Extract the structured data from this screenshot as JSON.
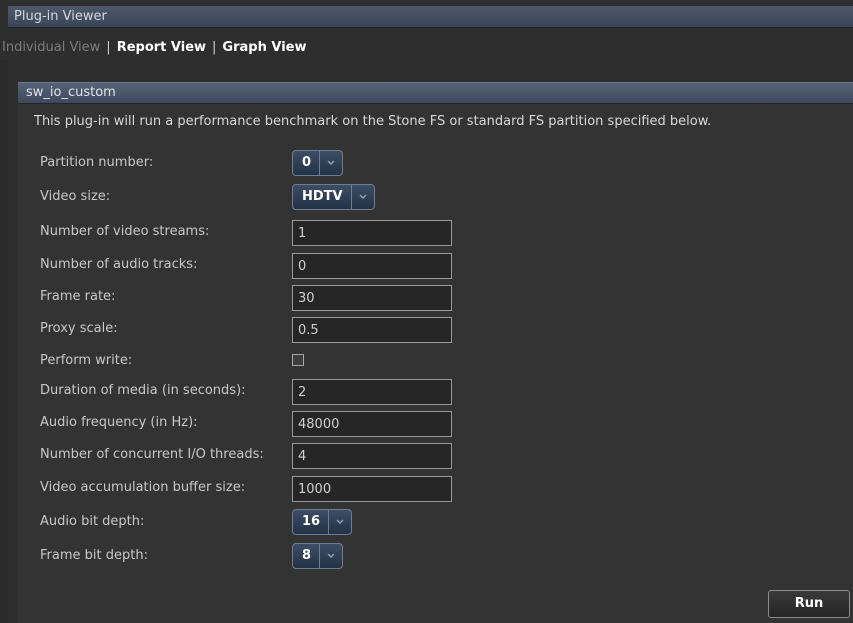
{
  "window": {
    "title": "Plug-in Viewer"
  },
  "tabs": [
    {
      "label": "Individual View",
      "state": "inactive"
    },
    {
      "label": "Report View",
      "state": "active"
    },
    {
      "label": "Graph View",
      "state": "active"
    }
  ],
  "tab_separator": "|",
  "panel": {
    "title": "sw_io_custom",
    "description": "This plug-in will run a performance benchmark on the Stone FS or standard FS partition specified below."
  },
  "fields": {
    "partition_number": {
      "label": "Partition number:",
      "value": "0"
    },
    "video_size": {
      "label": "Video size:",
      "value": "HDTV"
    },
    "video_streams": {
      "label": "Number of video streams:",
      "value": "1"
    },
    "audio_tracks": {
      "label": "Number of audio tracks:",
      "value": "0"
    },
    "frame_rate": {
      "label": "Frame rate:",
      "value": "30"
    },
    "proxy_scale": {
      "label": "Proxy scale:",
      "value": "0.5"
    },
    "perform_write": {
      "label": "Perform write:",
      "checked": false
    },
    "duration": {
      "label": "Duration of media (in seconds):",
      "value": "2"
    },
    "audio_frequency": {
      "label": "Audio frequency (in Hz):",
      "value": "48000"
    },
    "io_threads": {
      "label": "Number of concurrent I/O threads:",
      "value": "4"
    },
    "buffer_size": {
      "label": "Video accumulation buffer size:",
      "value": "1000"
    },
    "audio_bit_depth": {
      "label": "Audio bit depth:",
      "value": "16"
    },
    "frame_bit_depth": {
      "label": "Frame bit depth:",
      "value": "8"
    }
  },
  "actions": {
    "run_label": "Run"
  },
  "colors": {
    "background": "#2e2e2e",
    "header_blue": "#4e5a6c",
    "select_blue": "#2f3f55",
    "text": "#cfcfcf"
  },
  "icons": {
    "dropdown": "chevron-down-icon"
  }
}
